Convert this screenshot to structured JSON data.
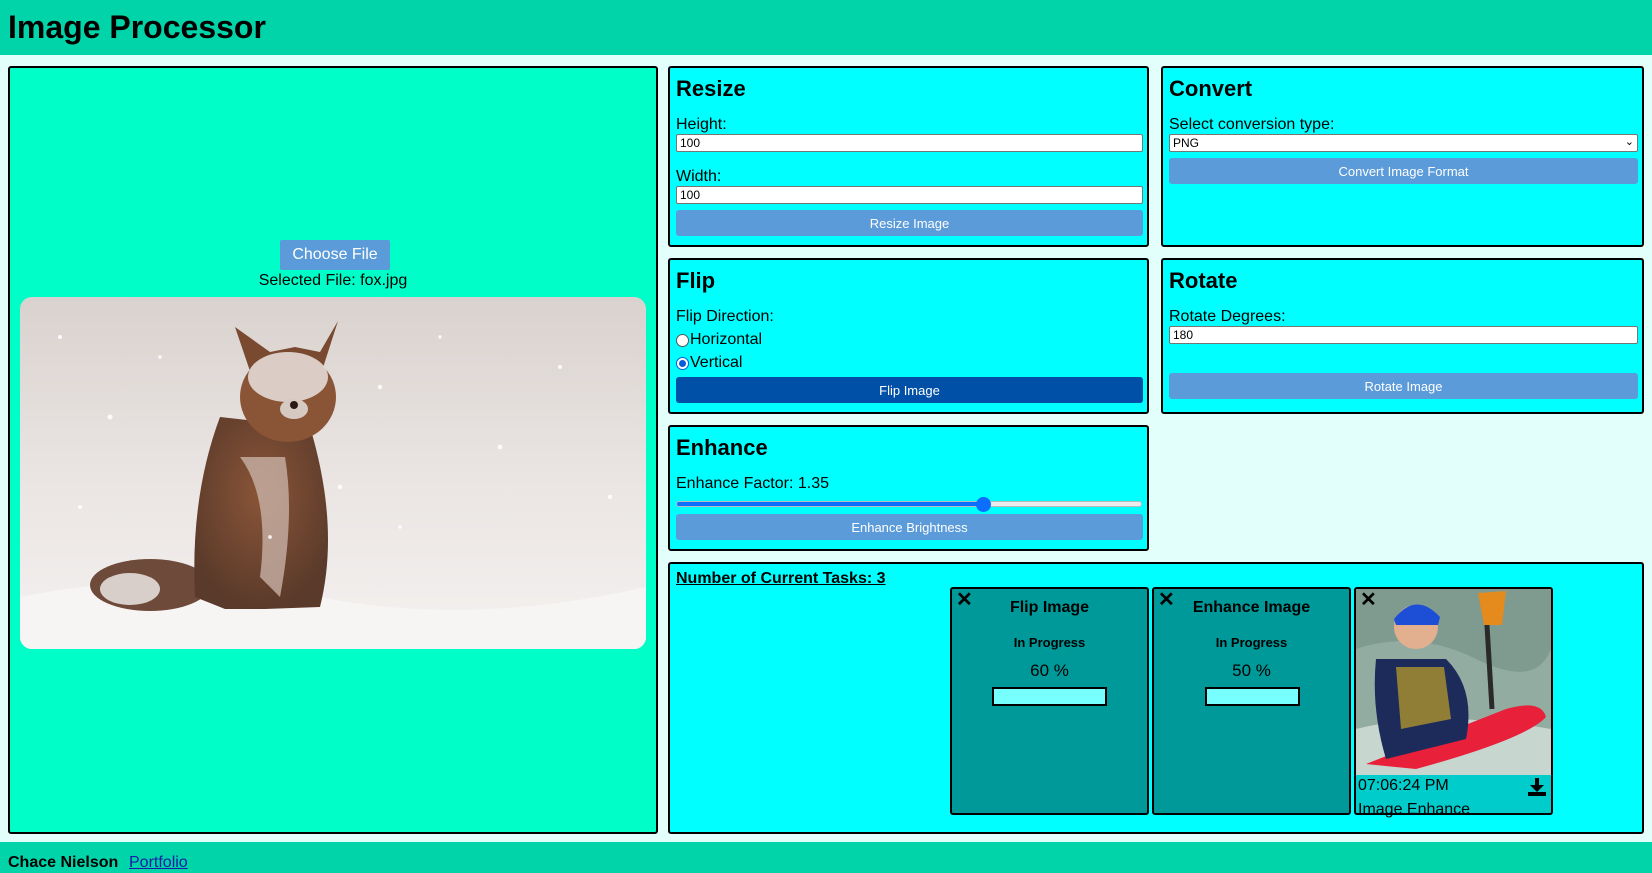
{
  "app": {
    "title": "Image Processor"
  },
  "upload": {
    "choose_label": "Choose File",
    "selected_file": "Selected File: fox.jpg"
  },
  "resize": {
    "title": "Resize",
    "height_label": "Height:",
    "height_value": "100",
    "width_label": "Width:",
    "width_value": "100",
    "button": "Resize Image"
  },
  "convert": {
    "title": "Convert",
    "select_label": "Select conversion type:",
    "selected": "PNG",
    "button": "Convert Image Format"
  },
  "flip": {
    "title": "Flip",
    "direction_label": "Flip Direction:",
    "options": [
      "Horizontal",
      "Vertical"
    ],
    "selected": "Vertical",
    "button": "Flip Image"
  },
  "rotate": {
    "title": "Rotate",
    "degrees_label": "Rotate Degrees:",
    "degrees_value": "180",
    "button": "Rotate Image"
  },
  "enhance": {
    "title": "Enhance",
    "factor_label": "Enhance Factor: 1.35",
    "factor_fraction": 0.66,
    "button": "Enhance Brightness"
  },
  "tasks": {
    "count_label": "Number of Current Tasks: 3",
    "items": [
      {
        "title": "Flip Image",
        "status": "In Progress",
        "percent_label": "60 %"
      },
      {
        "title": "Enhance Image",
        "status": "In Progress",
        "percent_label": "50 %"
      },
      {
        "time": "07:06:24 PM",
        "name": "Image Enhance"
      }
    ]
  },
  "footer": {
    "author": "Chace Nielson",
    "link": "Portfolio"
  },
  "colors": {
    "header": "#00d4a8",
    "left_panel": "#00ffc8",
    "card": "#00ffff",
    "task_card": "#009999",
    "button": "#5b9bd9",
    "button_active": "#0050a8"
  }
}
